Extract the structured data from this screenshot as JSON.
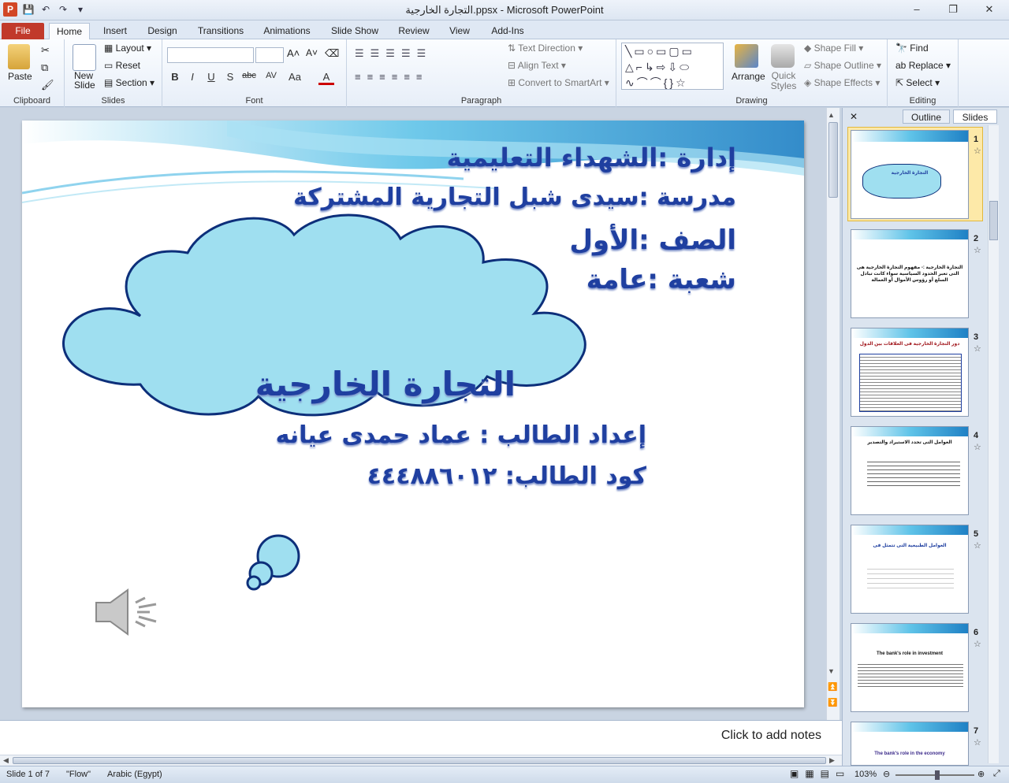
{
  "window": {
    "title": "التجارة الخارجية.ppsx  -  Microsoft PowerPoint",
    "min": "–",
    "max": "❐",
    "close": "✕",
    "app_badge": "P",
    "qat": [
      "💾",
      "↶",
      "↷",
      "▾"
    ]
  },
  "tabs": [
    "File",
    "Home",
    "Insert",
    "Design",
    "Transitions",
    "Animations",
    "Slide Show",
    "Review",
    "View",
    "Add-Ins"
  ],
  "ribbon": {
    "clipboard": {
      "label": "Clipboard",
      "paste": "Paste"
    },
    "slides": {
      "label": "Slides",
      "new_slide": "New Slide",
      "layout": "Layout",
      "reset": "Reset",
      "section": "Section"
    },
    "font": {
      "label": "Font",
      "buttons": [
        "B",
        "I",
        "U",
        "S",
        "abc",
        "AV",
        "Aa",
        "A"
      ]
    },
    "paragraph": {
      "label": "Paragraph",
      "text_direction": "Text Direction",
      "align_text": "Align Text",
      "convert": "Convert to SmartArt"
    },
    "drawing": {
      "label": "Drawing",
      "arrange": "Arrange",
      "quick_styles": "Quick Styles",
      "shape_fill": "Shape Fill",
      "shape_outline": "Shape Outline",
      "shape_effects": "Shape Effects"
    },
    "editing": {
      "label": "Editing",
      "find": "Find",
      "replace": "Replace",
      "select": "Select"
    }
  },
  "slide": {
    "header_lines": [
      "إدارة  :الشهداء التعليمية",
      "مدرسة :سيدى شبل التجارية المشتركة",
      "الصف  :الأول",
      "شعبة  :عامة"
    ],
    "cloud_title": "التجارة الخارجية",
    "cloud_line1": "إعداد الطالب : عماد حمدى عيانه",
    "cloud_line2": "كود الطالب:  ٤٤٤٨٨٦٠١٢"
  },
  "notes_placeholder": "Click to add notes",
  "panel": {
    "outline_tab": "Outline",
    "slides_tab": "Slides",
    "close": "✕",
    "thumbs": [
      {
        "num": "1",
        "text": "التجارة الخارجية"
      },
      {
        "num": "2",
        "text": "التجارة الخارجية :- مفهوم التجارة الخارجية هى التى تعبر الحدود السياسية سواء كانت تبادل السلع أو رؤوس الأموال أو العمالة"
      },
      {
        "num": "3",
        "text": "دور التجارة الخارجية فى العلاقات بين الدول"
      },
      {
        "num": "4",
        "text": "العوامل التى تحدد الاستيراد والتصدير"
      },
      {
        "num": "5",
        "text": "العوامل الطبيعية التى تتمثل فى"
      },
      {
        "num": "6",
        "text": "The bank's role in investment"
      },
      {
        "num": "7",
        "text": "The bank's role in the economy"
      }
    ]
  },
  "status": {
    "slide": "Slide 1 of 7",
    "theme": "\"Flow\"",
    "language": "Arabic (Egypt)",
    "zoom": "103%"
  },
  "colors": {
    "accent": "#1f3fa0",
    "cloud": "#9fdff0",
    "file_tab": "#c1392b"
  }
}
